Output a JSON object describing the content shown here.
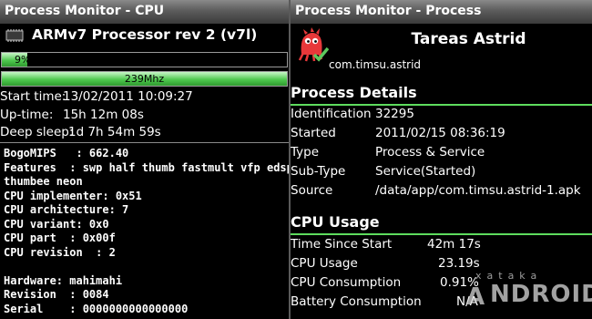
{
  "left_panel": {
    "title": "Process Monitor - CPU",
    "processor": "ARMv7 Processor rev 2 (v7l)",
    "load_bar": {
      "label": "9%",
      "value": 0.09
    },
    "frequency_bar": {
      "label": "239Mhz",
      "value": 1.0
    },
    "stats": [
      {
        "label": "Start time:",
        "value": "13/02/2011 10:09:27"
      },
      {
        "label": "Up-time:",
        "value": "15h 12m 08s"
      },
      {
        "label": "Deep sleep:",
        "value": "1d 7h 54m 59s"
      }
    ],
    "cpuinfo": [
      "BogoMIPS   : 662.40",
      "Features  : swp half thumb fastmult vfp edsp",
      "thumbee neon",
      "CPU implementer: 0x51",
      "CPU architecture: 7",
      "CPU variant: 0x0",
      "CPU part  : 0x00f",
      "CPU revision  : 2",
      "",
      "Hardware: mahimahi",
      "Revision  : 0084",
      "Serial    : 0000000000000000"
    ]
  },
  "right_panel": {
    "title": "Process Monitor - Process",
    "app_name": "Tareas Astrid",
    "package": "com.timsu.astrid",
    "details_title": "Process Details",
    "details": [
      {
        "label": "Identification",
        "value": "32295"
      },
      {
        "label": "Started",
        "value": "2011/02/15 08:36:19"
      },
      {
        "label": "Type",
        "value": "Process & Service"
      },
      {
        "label": "Sub-Type",
        "value": "Service(Started)"
      },
      {
        "label": "Source",
        "value": "/data/app/com.timsu.astrid-1.apk"
      }
    ],
    "cpu_title": "CPU Usage",
    "cpu_usage": [
      {
        "label": "Time Since Start",
        "value": "42m 17s"
      },
      {
        "label": "CPU Usage",
        "value": "23.19s"
      },
      {
        "label": "CPU Consumption",
        "value": "0.91%"
      },
      {
        "label": "Battery Consumption",
        "value": "N/A"
      }
    ]
  },
  "watermark": {
    "top": "xataka",
    "bottom": "NDROID",
    "letter": "A"
  },
  "colors": {
    "bar_green": "#4fc84f",
    "section_line": "#5edc5e",
    "icon_red": "#e8383a"
  }
}
